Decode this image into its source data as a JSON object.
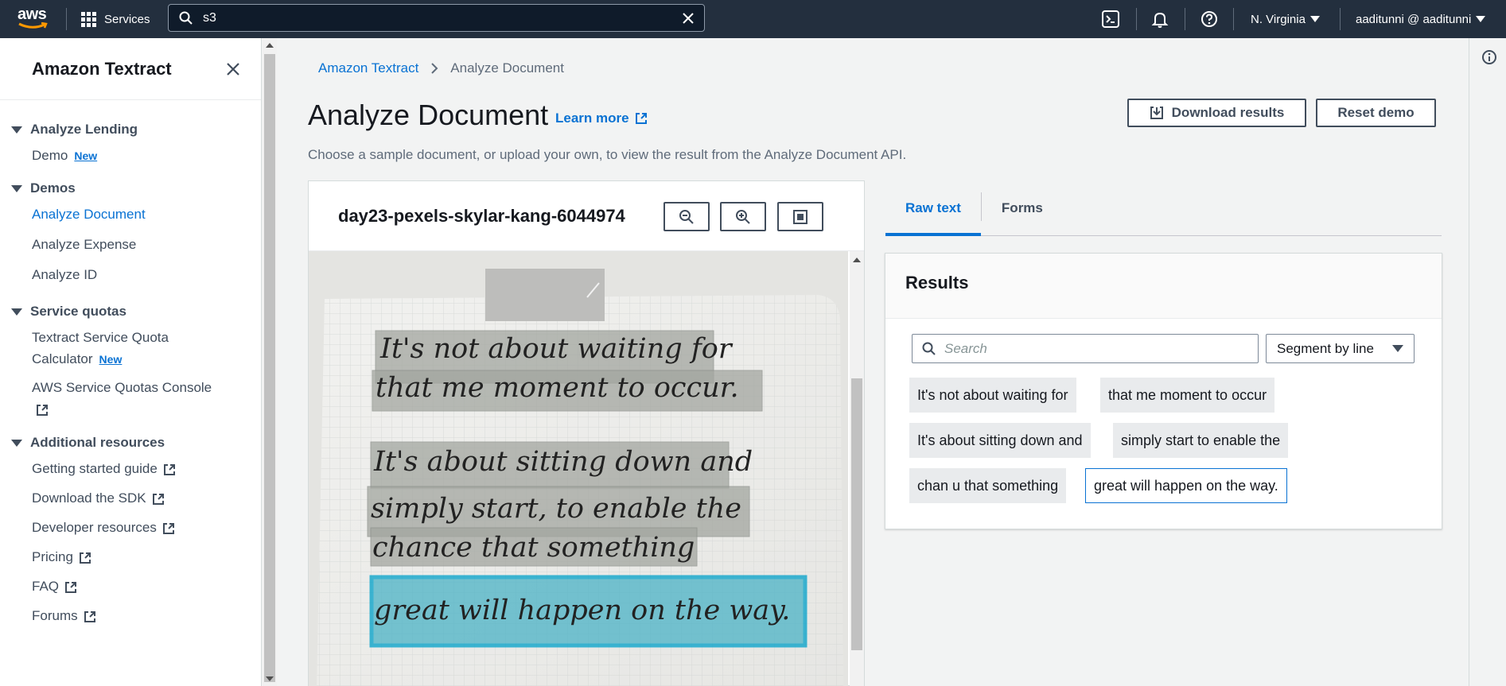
{
  "topnav": {
    "logo_text": "aws",
    "services_label": "Services",
    "search_value": "s3",
    "region": "N. Virginia",
    "account": "aaditunni @ aaditunni"
  },
  "sidebar": {
    "title": "Amazon Textract",
    "groups": [
      {
        "label": "Analyze Lending",
        "items": [
          {
            "label": "Demo",
            "badge": "New"
          }
        ]
      },
      {
        "label": "Demos",
        "items": [
          {
            "label": "Analyze Document"
          },
          {
            "label": "Analyze Expense"
          },
          {
            "label": "Analyze ID"
          }
        ]
      },
      {
        "label": "Service quotas",
        "items": [
          {
            "label_line1": "Textract Service Quota",
            "label_line2": "Calculator",
            "badge": "New"
          },
          {
            "label": "AWS Service Quotas Console"
          }
        ]
      },
      {
        "label": "Additional resources",
        "items": [
          {
            "label": "Getting started guide"
          },
          {
            "label": "Download the SDK"
          },
          {
            "label": "Developer resources"
          },
          {
            "label": "Pricing"
          },
          {
            "label": "FAQ"
          },
          {
            "label": "Forums"
          }
        ]
      }
    ]
  },
  "breadcrumb": {
    "root": "Amazon Textract",
    "current": "Analyze Document"
  },
  "header": {
    "title": "Analyze Document",
    "learn_more": "Learn more",
    "description": "Choose a sample document, or upload your own, to view the result from the Analyze Document API.",
    "download_label": "Download results",
    "reset_label": "Reset demo"
  },
  "document": {
    "name": "day23-pexels-skylar-kang-6044974",
    "handwriting": [
      "It's not about waiting for",
      "that me moment to occur.",
      "It's about sitting down and",
      "simply start, to enable the",
      "chance that something",
      "great will happen on the way."
    ]
  },
  "results": {
    "tabs": [
      "Raw text",
      "Forms"
    ],
    "heading": "Results",
    "search_placeholder": "Search",
    "segment_label": "Segment by line",
    "lines": [
      "It's not about waiting for",
      "that me moment to occur",
      "It's about sitting down and",
      "simply start to enable the",
      "chan u that something",
      "great will happen on the way."
    ]
  },
  "colors": {
    "accent": "#0972d3",
    "nav_bg": "#232f3e",
    "highlight": "#00a1c9"
  }
}
